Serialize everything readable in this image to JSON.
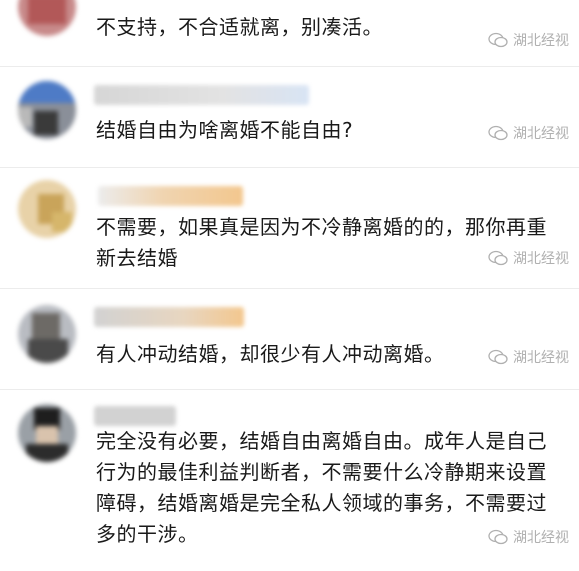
{
  "watermark": {
    "label": "湖北经视",
    "icon": "wechat-icon"
  },
  "comments": [
    {
      "text": "不支持，不合适就离，别凑活。"
    },
    {
      "text": "结婚自由为啥离婚不能自由?"
    },
    {
      "text": "不需要，如果真是因为不冷静离婚的的，那你再重新去结婚"
    },
    {
      "text": "有人冲动结婚，却很少有人冲动离婚。"
    },
    {
      "text": "完全没有必要，结婚自由离婚自由。成年人是自己行为的最佳利益判断者，不需要什么冷静期来设置障碍，结婚离婚是完全私人领域的事务，不需要过多的干涉。"
    }
  ],
  "colors": {
    "text": "#1a1a1a",
    "watermark": "#b0b0b0",
    "divider": "#ececec"
  }
}
